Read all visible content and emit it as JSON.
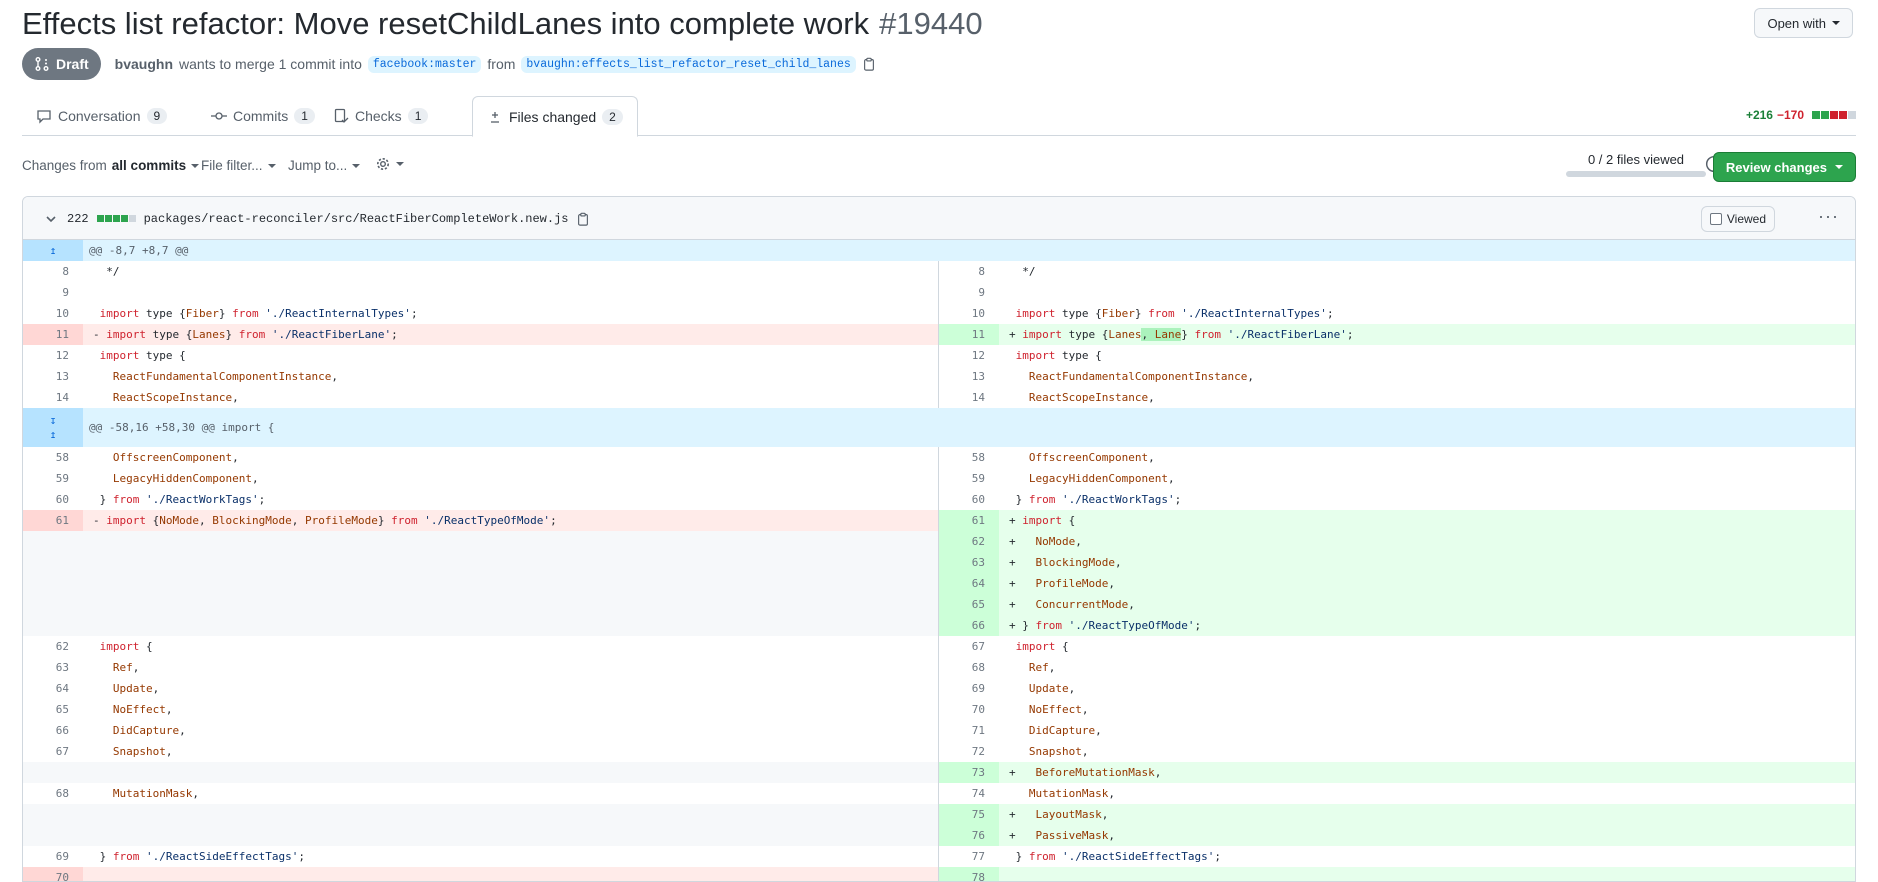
{
  "pr": {
    "title": "Effects list refactor: Move resetChildLanes into complete work",
    "number": "#19440",
    "open_with": "Open with",
    "status": "Draft",
    "author": "bvaughn",
    "merge_text": "wants to merge 1 commit into",
    "base_branch": "facebook:master",
    "from_text": "from",
    "head_branch": "bvaughn:effects_list_refactor_reset_child_lanes"
  },
  "tabs": [
    {
      "label": "Conversation",
      "count": "9"
    },
    {
      "label": "Commits",
      "count": "1"
    },
    {
      "label": "Checks",
      "count": "1"
    },
    {
      "label": "Files changed",
      "count": "2"
    }
  ],
  "diffstat": {
    "additions": "+216",
    "deletions": "−170"
  },
  "toolbar": {
    "changes_from": "Changes from",
    "all_commits": "all commits",
    "file_filter": "File filter...",
    "jump_to": "Jump to...",
    "files_viewed": "0 / 2 files viewed",
    "review_changes": "Review changes"
  },
  "file": {
    "changes": "222",
    "path": "packages/react-reconciler/src/ReactFiberCompleteWork.new.js",
    "viewed_label": "Viewed",
    "hunk1": "@@ -8,7 +8,7 @@",
    "hunk2": "@@ -58,16 +58,30 @@ import {"
  },
  "colors": {
    "addition": "#2da44e",
    "deletion": "#cf222e",
    "neutral": "#d0d7de",
    "accent": "#0969da"
  }
}
